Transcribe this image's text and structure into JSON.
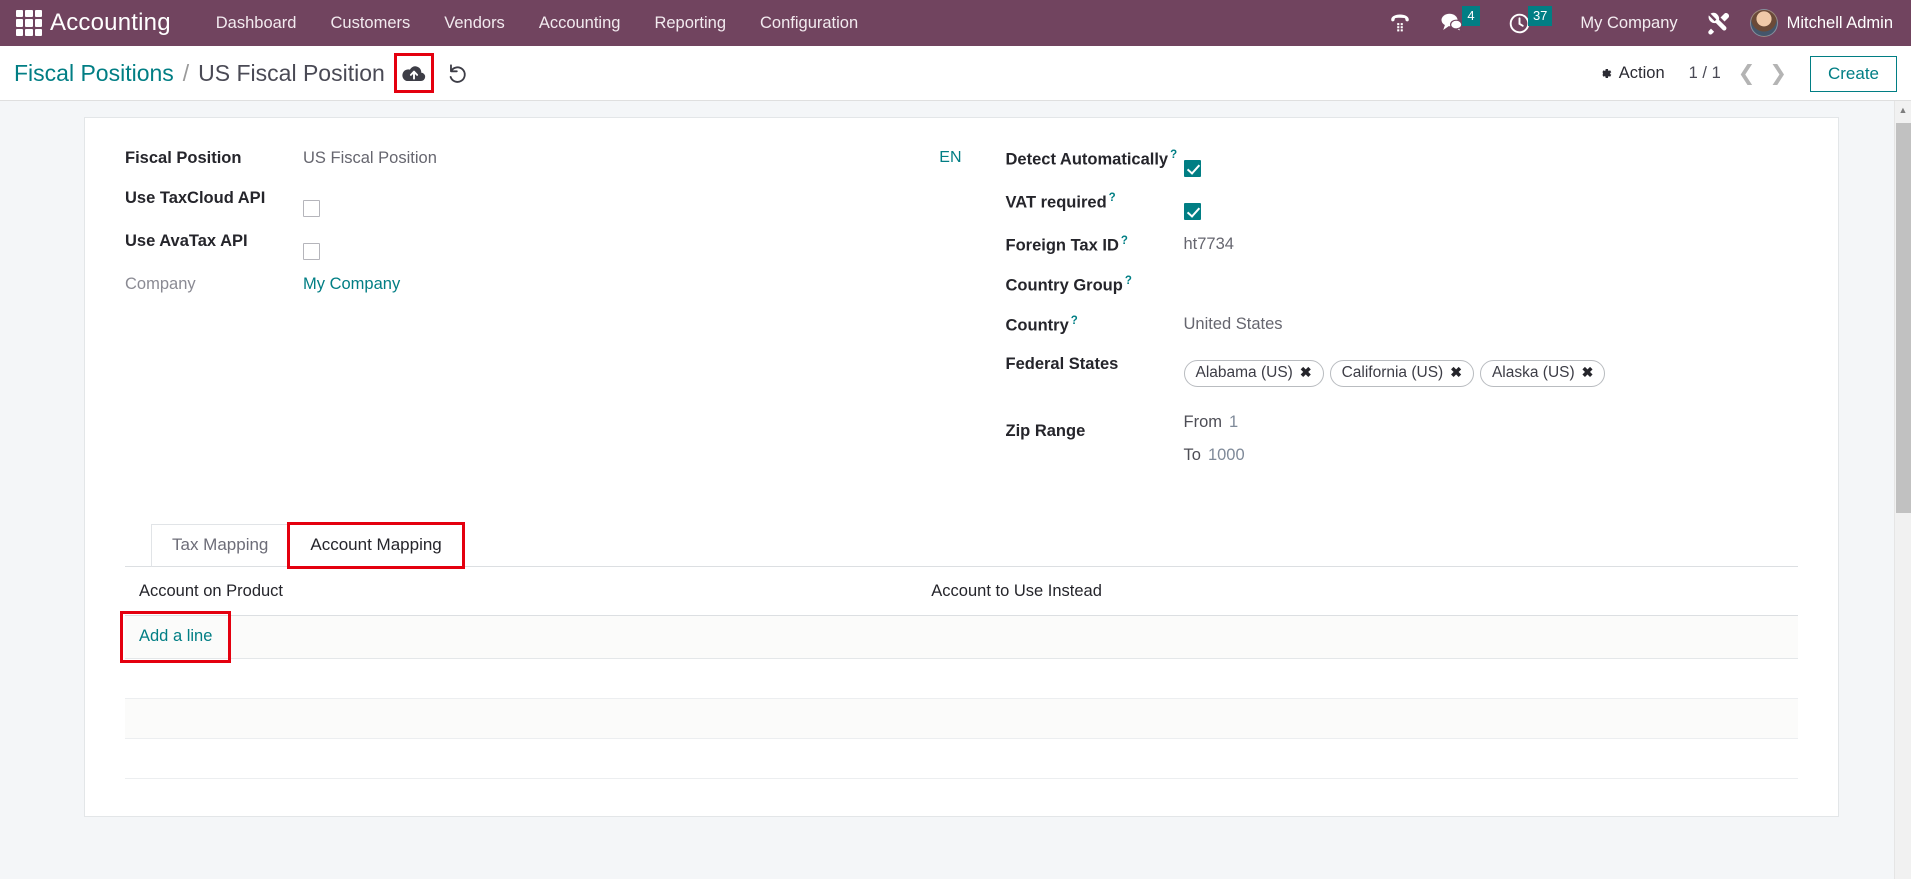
{
  "navbar": {
    "apps_icon": "apps-grid-icon",
    "brand": "Accounting",
    "menu": [
      {
        "label": "Dashboard"
      },
      {
        "label": "Customers"
      },
      {
        "label": "Vendors"
      },
      {
        "label": "Accounting"
      },
      {
        "label": "Reporting"
      },
      {
        "label": "Configuration"
      }
    ],
    "icons": {
      "phone": "phone-dialpad-icon",
      "messages": "chat-bubble-icon",
      "activities": "clock-icon",
      "tools": "wrench-screwdriver-icon"
    },
    "messages_count": "4",
    "activities_count": "37",
    "company": "My Company",
    "user": "Mitchell Admin",
    "colors": {
      "background": "#71445f",
      "badge": "#017e84"
    }
  },
  "control_panel": {
    "breadcrumb_parent": "Fiscal Positions",
    "breadcrumb_separator": "/",
    "breadcrumb_current": "US Fiscal Position",
    "save_icon": "cloud-upload-icon",
    "discard_icon": "undo-icon",
    "action_label": "Action",
    "action_icon": "gear-icon",
    "pager": "1 / 1",
    "prev_icon": "chevron-left-icon",
    "next_icon": "chevron-right-icon",
    "create_label": "Create"
  },
  "form": {
    "left": {
      "fiscal_position_label": "Fiscal Position",
      "fiscal_position_value": "US Fiscal Position",
      "lang_tag": "EN",
      "taxcloud_label": "Use TaxCloud API",
      "taxcloud_checked": false,
      "avatax_label": "Use AvaTax API",
      "avatax_checked": false,
      "company_label": "Company",
      "company_value": "My Company"
    },
    "right": {
      "detect_label": "Detect Automatically",
      "detect_checked": true,
      "vat_label": "VAT required",
      "vat_checked": true,
      "foreign_tax_id_label": "Foreign Tax ID",
      "foreign_tax_id_value": "ht7734",
      "country_group_label": "Country Group",
      "country_group_value": "",
      "country_label": "Country",
      "country_value": "United States",
      "federal_states_label": "Federal States",
      "federal_states": [
        {
          "label": "Alabama (US)"
        },
        {
          "label": "California (US)"
        },
        {
          "label": "Alaska (US)"
        }
      ],
      "zip_label": "Zip Range",
      "zip_from_key": "From",
      "zip_from_value": "1",
      "zip_to_key": "To",
      "zip_to_value": "1000"
    },
    "help_marker": "?"
  },
  "notebook": {
    "tabs": [
      {
        "label": "Tax Mapping",
        "active": false
      },
      {
        "label": "Account Mapping",
        "active": true
      }
    ],
    "table": {
      "columns": [
        {
          "label": "Account on Product"
        },
        {
          "label": "Account to Use Instead"
        }
      ],
      "rows": [],
      "add_line_label": "Add a line"
    }
  },
  "highlights": {
    "color": "#e4000f",
    "targets": [
      "save-button",
      "tab-account-mapping",
      "add-a-line-link"
    ]
  }
}
